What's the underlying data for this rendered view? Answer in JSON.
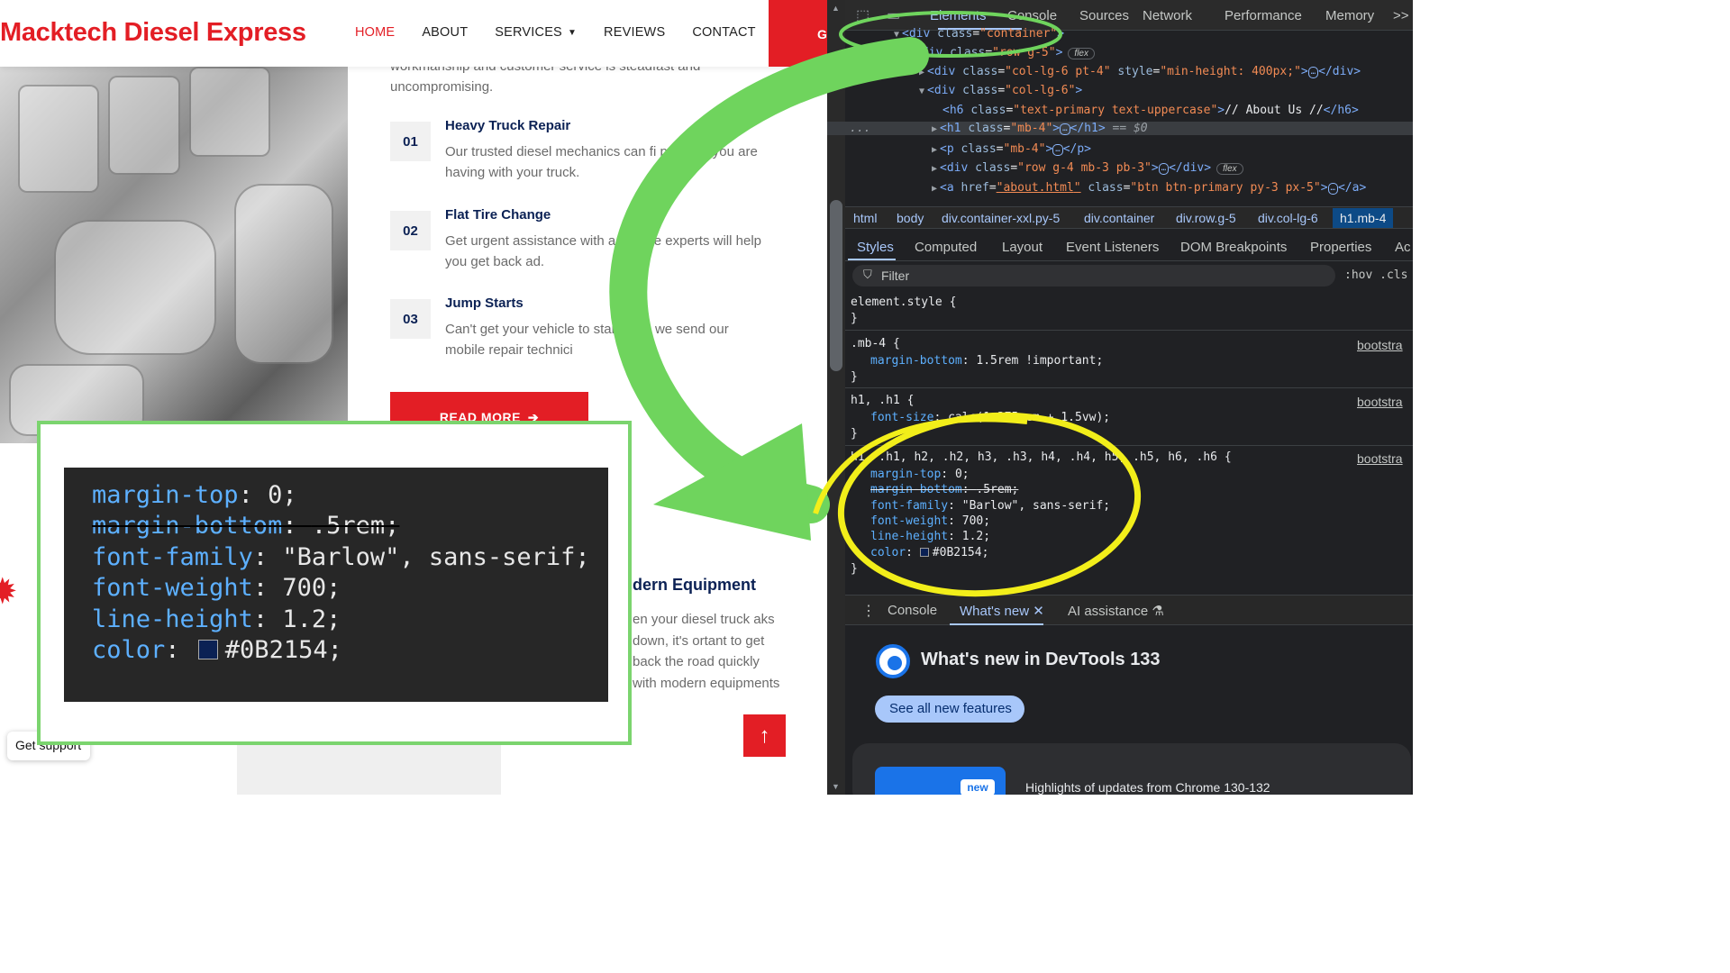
{
  "site": {
    "brand": "Macktech Diesel Express",
    "nav": [
      {
        "label": "HOME",
        "active": true
      },
      {
        "label": "ABOUT",
        "active": false
      },
      {
        "label": "SERVICES",
        "active": false
      },
      {
        "label": "REVIEWS",
        "active": false
      },
      {
        "label": "CONTACT",
        "active": false
      }
    ],
    "quote_tab": "G",
    "intro_text": "workmanship and customer service is steadfast and uncompromising.",
    "services": [
      {
        "num": "01",
        "title": "Heavy Truck Repair",
        "desc": "Our trusted diesel mechanics can fi problem you are having with your truck."
      },
      {
        "num": "02",
        "title": "Flat Tire Change",
        "desc": "Get urgent assistance with a f ur tire experts will help you get back ad."
      },
      {
        "num": "03",
        "title": "Jump Starts",
        "desc": "Can't get your vehicle to start w so we send our mobile repair technici"
      }
    ],
    "read_more": "READ MORE",
    "modern_title": "dern Equipment",
    "modern_desc": "en your diesel truck aks down, it's ortant to get back the road quickly with modern equipments",
    "support": "Get support",
    "back_to_top": "↑"
  },
  "zoom": {
    "lines": [
      {
        "prop": "margin-top",
        "value": "0;",
        "struck": false
      },
      {
        "prop": "margin-bottom",
        "value": ".5rem;",
        "struck": true
      },
      {
        "prop": "font-family",
        "value": "\"Barlow\", sans-serif;",
        "struck": false
      },
      {
        "prop": "font-weight",
        "value": "700;",
        "struck": false
      },
      {
        "prop": "line-height",
        "value": "1.2;",
        "struck": false
      },
      {
        "prop": "color",
        "value": "#0B2154;",
        "struck": false
      }
    ],
    "swatch_color": "#0B2154"
  },
  "devtools": {
    "tabs": [
      "Elements",
      "Console",
      "Sources",
      "Network",
      "Performance",
      "Memory"
    ],
    "active_tab": "Elements",
    "more": ">>",
    "dom": {
      "l0_class": "container",
      "l1_class": "row g-5",
      "l1_badge": "flex",
      "l2_class": "col-lg-6 pt-4",
      "l2_style": "min-height: 400px;",
      "l3_class": "col-lg-6",
      "l4_class": "text-primary text-uppercase",
      "l4_text": "// About Us //",
      "l5_class": "mb-4",
      "l5_suffix": "== $0",
      "l6_class": "mb-4",
      "l7_class": "row g-4 mb-3 pb-3",
      "l7_badge": "flex",
      "l8_href": "about.html",
      "l8_class": "btn btn-primary py-3 px-5",
      "gutter": "..."
    },
    "breadcrumbs": [
      "html",
      "body",
      "div.container-xxl.py-5",
      "div.container",
      "div.row.g-5",
      "div.col-lg-6",
      "h1.mb-4"
    ],
    "subtabs": [
      "Styles",
      "Computed",
      "Layout",
      "Event Listeners",
      "DOM Breakpoints",
      "Properties",
      "Ac"
    ],
    "filter_placeholder": "Filter",
    "hov_cls": ":hov .cls",
    "rules": {
      "element_style": "element.style {",
      "close": "}",
      "mb4_selector": ".mb-4 {",
      "mb4_prop": "margin-bottom",
      "mb4_value": "1.5rem !important;",
      "h1_selector": "h1, .h1 {",
      "h1_prop": "font-size",
      "h1_value": "calc(1.375rem + 1.5vw);",
      "h_selector": "h1, .h1, h2, .h2, h3, .h3, h4, .h4, h5, .h5, h6, .h6 {",
      "h_props": [
        {
          "prop": "margin-top",
          "value": "0;"
        },
        {
          "prop": "margin-bottom",
          "value": ".5rem;"
        },
        {
          "prop": "font-family",
          "value": "\"Barlow\", sans-serif;"
        },
        {
          "prop": "font-weight",
          "value": "700;"
        },
        {
          "prop": "line-height",
          "value": "1.2;"
        },
        {
          "prop": "color",
          "value": "#0B2154;"
        }
      ],
      "source": "bootstra"
    },
    "drawer_tabs": [
      "Console",
      "What's new",
      "AI assistance"
    ],
    "whats_new_title": "What's new in DevTools 133",
    "see_all": "See all new features",
    "card_badge": "new",
    "card_text": "Highlights of updates from Chrome 130-132"
  },
  "colors": {
    "brand_red": "#e31e25",
    "navy": "#0B2154",
    "annotation_green": "#6fd45d",
    "annotation_yellow": "#f2ee1a"
  }
}
